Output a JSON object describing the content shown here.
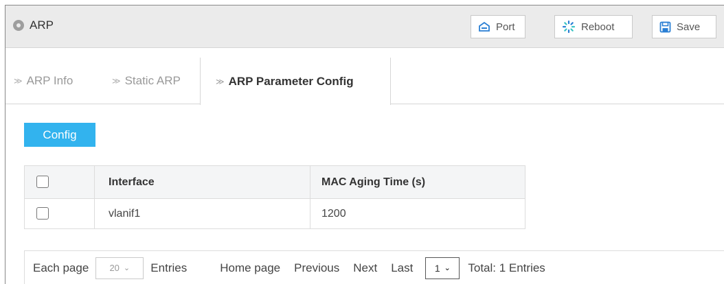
{
  "header": {
    "title": "ARP",
    "buttons": {
      "port": "Port",
      "reboot": "Reboot",
      "save": "Save"
    }
  },
  "tabs": [
    {
      "label": "ARP Info",
      "active": false
    },
    {
      "label": "Static ARP",
      "active": false
    },
    {
      "label": "ARP Parameter Config",
      "active": true
    }
  ],
  "toolbar": {
    "config_label": "Config"
  },
  "table": {
    "columns": [
      "Interface",
      "MAC Aging Time (s)"
    ],
    "rows": [
      {
        "interface": "vlanif1",
        "mac_aging_time": "1200"
      }
    ]
  },
  "pagination": {
    "each_page_label": "Each page",
    "page_size": "20",
    "entries_label": "Entries",
    "home_label": "Home page",
    "previous_label": "Previous",
    "next_label": "Next",
    "last_label": "Last",
    "current_page": "1",
    "total_label": "Total: 1 Entries"
  },
  "colors": {
    "accent": "#32b3ee",
    "header_bg": "#ebebeb"
  },
  "icons": {
    "title": "radio-dot-icon",
    "port": "port-icon",
    "reboot": "reboot-spinner-icon",
    "save": "floppy-save-icon"
  }
}
